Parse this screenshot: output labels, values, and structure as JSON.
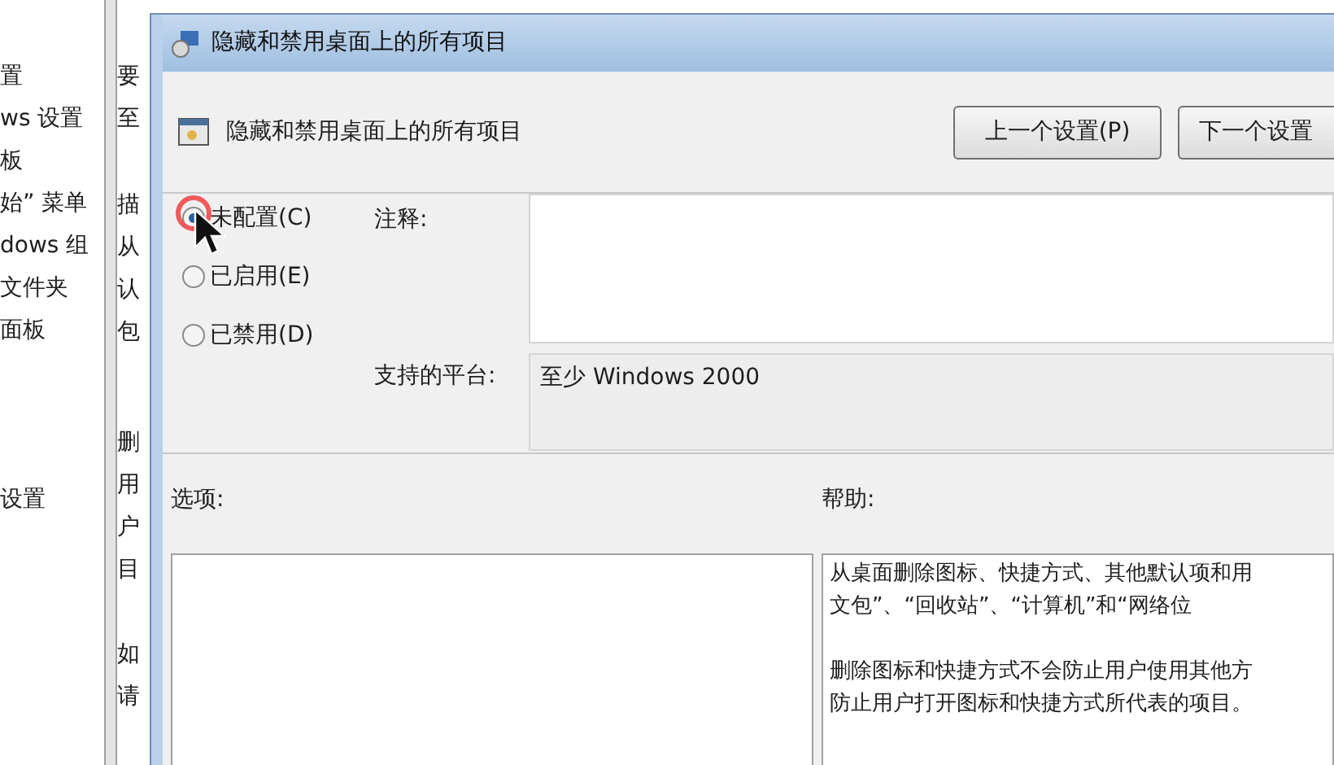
{
  "background_window": {
    "tree_items": [
      {
        "label": "置",
        "selected": false
      },
      {
        "label": "ws 设置",
        "selected": false
      },
      {
        "label": "板",
        "selected": false
      },
      {
        "label": "始” 菜单",
        "selected": false
      },
      {
        "label": "dows 组",
        "selected": false
      },
      {
        "label": "文件夹",
        "selected": false
      },
      {
        "label": "面板",
        "selected": false
      },
      {
        "label": "设置",
        "selected": false
      }
    ],
    "description_fragments": [
      [
        "要",
        "至"
      ],
      [
        "描",
        "从",
        "认",
        "包"
      ],
      [
        "删",
        "用",
        "户",
        "目"
      ],
      [
        "如",
        "请"
      ]
    ]
  },
  "dialog": {
    "title": "隐藏和禁用桌面上的所有项目",
    "heading": "隐藏和禁用桌面上的所有项目",
    "buttons": [
      "上一个设置(P)",
      "下一个设置"
    ],
    "radios": [
      {
        "label": "未配置(C)",
        "selected": true
      },
      {
        "label": "已启用(E)",
        "selected": false
      },
      {
        "label": "已禁用(D)",
        "selected": false
      }
    ],
    "comment_label": "注释:",
    "platform_label": "支持的平台:",
    "platform_value": "至少 Windows 2000",
    "options_label": "选项:",
    "help_label": "帮助:",
    "help_paragraphs": [
      [
        "从桌面删除图标、快捷方式、其他默认项和用",
        "文包”、“回收站”、“计算机”和“网络位"
      ],
      [
        "删除图标和快捷方式不会防止用户使用其他方",
        "防止用户打开图标和快捷方式所代表的项目。"
      ]
    ]
  }
}
